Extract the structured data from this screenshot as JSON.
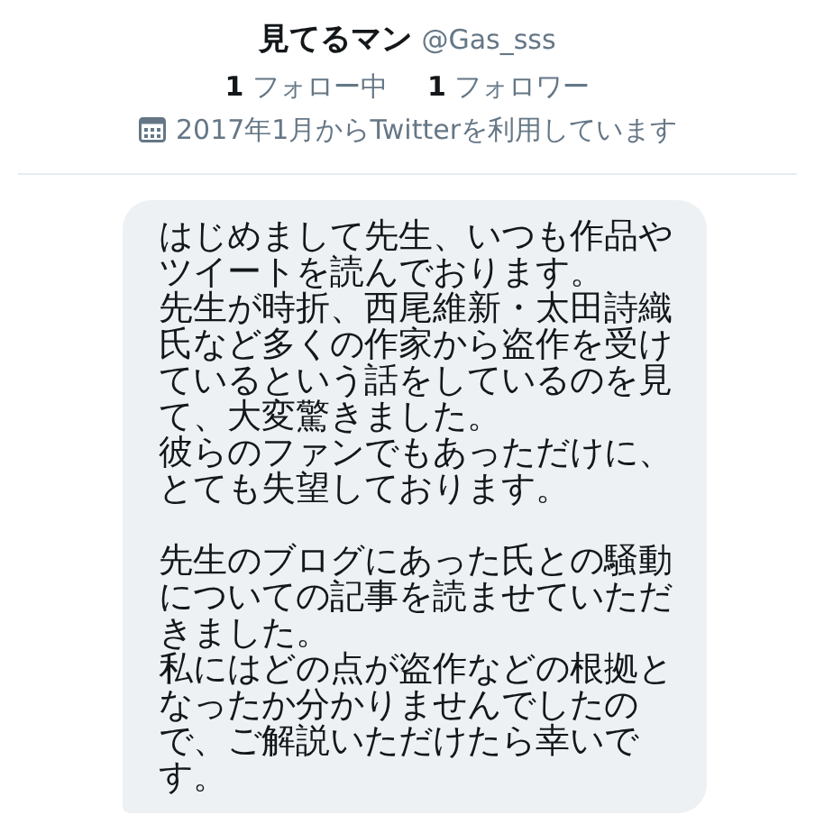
{
  "profile": {
    "name": "見てるマン",
    "handle": "@Gas_sss",
    "stats": [
      {
        "count": "1",
        "label": "フォロー中"
      },
      {
        "count": "1",
        "label": "フォロワー"
      }
    ],
    "joined": "2017年1月からTwitterを利用しています"
  },
  "message": {
    "paragraphs": [
      {
        "lines": [
          "はじめまして先生、いつも作品やツイートを読んでおります。",
          "先生が時折、西尾維新・太田詩織氏など多くの作家から盗作を受けているという話をしているのを見て、大変驚きました。",
          "彼らのファンでもあっただけに、とても失望しております。"
        ]
      },
      {
        "lines": [
          "先生のブログにあった氏との騒動についての記事を読ませていただきました。",
          "私にはどの点が盗作などの根拠となったか分かりませんでしたので、ご解説いただけたら幸いです。"
        ]
      }
    ]
  }
}
